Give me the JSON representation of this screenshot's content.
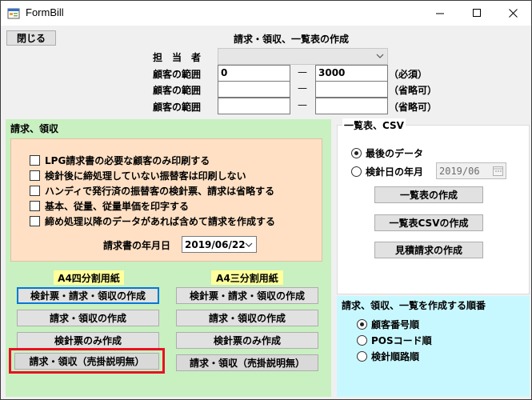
{
  "window": {
    "title": "FormBill"
  },
  "top": {
    "close_button": "閉じる",
    "heading": "請求・領収、一覧表の作成",
    "staff_label": "担　当　者",
    "staff_value": "",
    "range_label": "顧客の範囲",
    "dash": "—",
    "ranges": [
      {
        "from": "0",
        "to": "3000",
        "note": "（必須）"
      },
      {
        "from": "",
        "to": "",
        "note": "（省略可）"
      },
      {
        "from": "",
        "to": "",
        "note": "（省略可）"
      }
    ]
  },
  "billing": {
    "title": "請求、領収",
    "options": [
      {
        "label": "LPG請求書の必要な顧客のみ印刷する",
        "checked": false
      },
      {
        "label": "検針後に締処理していない振替客は印刷しない",
        "checked": false
      },
      {
        "label": "ハンディで発行済の振替客の検針票、請求は省略する",
        "checked": false
      },
      {
        "label": "基本、従量、従量単価を印字する",
        "checked": false
      },
      {
        "label": "締め処理以降のデータがあれば含めて請求を作成する",
        "checked": false
      }
    ],
    "date_label": "請求書の年月日",
    "date_value": "2019/06/22",
    "a4_four": "A4四分割用紙",
    "a4_three": "A4三分割用紙",
    "buttons": {
      "meter_bill_receipt": "検針票・請求・領収の作成",
      "bill_receipt": "請求・領収の作成",
      "meter_only": "検針票のみ作成",
      "bill_receipt_no_detail": "請求・領収（売掛説明無）"
    }
  },
  "list_csv": {
    "title": "一覧表、CSV",
    "radio_latest": "最後のデータ",
    "radio_month": "検針日の年月",
    "month_value": "2019/06",
    "buttons": {
      "list": "一覧表の作成",
      "list_csv": "一覧表CSVの作成",
      "estimate": "見積請求の作成"
    }
  },
  "order": {
    "title": "請求、領収、一覧を作成する順番",
    "options": [
      "顧客番号順",
      "POSコード順",
      "検針順路順"
    ],
    "selected": 0
  },
  "colors": {
    "green_panel": "#c8f0c0",
    "peach_panel": "#ffe0c4",
    "cyan_panel": "#c8f8ff",
    "yellow_label": "#ffff9c",
    "focus_blue": "#0078d7",
    "highlight_red": "#e81123"
  },
  "icons": {
    "app": "form-icon",
    "minimize": "minimize-icon",
    "maximize": "maximize-icon",
    "close": "close-icon",
    "dropdown": "chevron-down-icon",
    "calendar": "calendar-icon"
  }
}
